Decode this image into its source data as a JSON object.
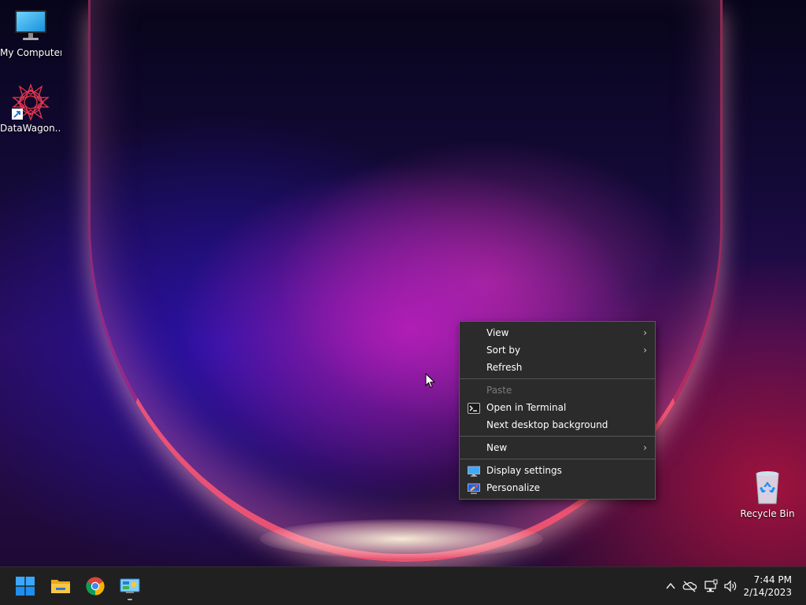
{
  "desktop": {
    "icons": [
      {
        "label": "My Computer",
        "icon": "computer-monitor-icon"
      },
      {
        "label": "DataWagon...",
        "icon": "datawagon-app-icon"
      },
      {
        "label": "Recycle Bin",
        "icon": "recycle-bin-icon"
      }
    ]
  },
  "context_menu": {
    "items": [
      {
        "label": "View",
        "submenu": true,
        "enabled": true
      },
      {
        "label": "Sort by",
        "submenu": true,
        "enabled": true
      },
      {
        "label": "Refresh",
        "submenu": false,
        "enabled": true
      },
      {
        "label": "Paste",
        "submenu": false,
        "enabled": false
      },
      {
        "label": "Open in Terminal",
        "submenu": false,
        "enabled": true,
        "icon": "terminal-icon"
      },
      {
        "label": "Next desktop background",
        "submenu": false,
        "enabled": true
      },
      {
        "label": "New",
        "submenu": true,
        "enabled": true
      },
      {
        "label": "Display settings",
        "submenu": false,
        "enabled": true,
        "icon": "display-icon"
      },
      {
        "label": "Personalize",
        "submenu": false,
        "enabled": true,
        "icon": "personalize-icon"
      }
    ],
    "submenu_glyph": "›"
  },
  "taskbar": {
    "apps": [
      {
        "name": "start-button",
        "icon": "windows-logo-icon"
      },
      {
        "name": "file-explorer",
        "icon": "folder-icon"
      },
      {
        "name": "chrome",
        "icon": "chrome-icon"
      },
      {
        "name": "control-panel",
        "icon": "control-panel-icon"
      }
    ],
    "tray": {
      "overflow_glyph": "^",
      "icons": [
        "chevron-up-icon",
        "onedrive-offline-icon",
        "network-icon",
        "volume-icon"
      ]
    },
    "clock": {
      "time": "7:44 PM",
      "date": "2/14/2023"
    }
  },
  "colors": {
    "menu_bg": "#2b2b2b",
    "taskbar_bg": "#202020",
    "windows_blue": "#1e90ff"
  }
}
